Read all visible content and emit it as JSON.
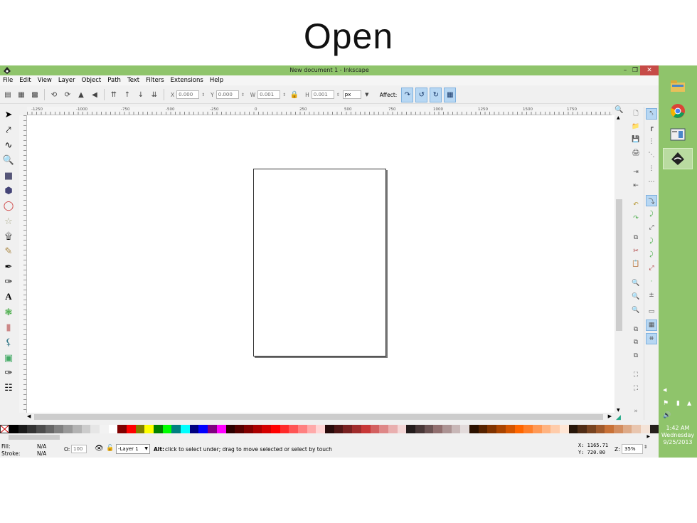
{
  "slide": {
    "title": "Open"
  },
  "window": {
    "title": "New document 1 - Inkscape"
  },
  "menu": [
    "File",
    "Edit",
    "View",
    "Layer",
    "Object",
    "Path",
    "Text",
    "Filters",
    "Extensions",
    "Help"
  ],
  "toolbar": {
    "x_label": "X",
    "x_value": "0.000",
    "y_label": "Y",
    "y_value": "0.000",
    "w_label": "W",
    "w_value": "0.001",
    "h_label": "H",
    "h_value": "0.001",
    "unit": "px",
    "affect_label": "Affect:"
  },
  "ruler": {
    "ticks": [
      "-1250",
      "-1000",
      "-750",
      "-500",
      "-250",
      "0",
      "250",
      "500",
      "750",
      "1000",
      "1250",
      "1500",
      "1750"
    ]
  },
  "palette_colors": [
    "#000000",
    "#1a1a1a",
    "#333333",
    "#4d4d4d",
    "#666666",
    "#808080",
    "#999999",
    "#b3b3b3",
    "#cccccc",
    "#e6e6e6",
    "#f2f2f2",
    "#ffffff",
    "#800000",
    "#ff0000",
    "#808000",
    "#ffff00",
    "#008000",
    "#00ff00",
    "#008080",
    "#00ffff",
    "#000080",
    "#0000ff",
    "#800080",
    "#ff00ff",
    "#2b0000",
    "#550000",
    "#800000",
    "#aa0000",
    "#d40000",
    "#ff0000",
    "#ff2a2a",
    "#ff5555",
    "#ff8080",
    "#ffaaaa",
    "#ffd5d5",
    "#280b0b",
    "#501616",
    "#782121",
    "#a02c2c",
    "#c83737",
    "#d35f5f",
    "#de8787",
    "#e9afaf",
    "#f4d7d7",
    "#241c1c",
    "#483737",
    "#6c5353",
    "#916f6f",
    "#ac9393",
    "#c8b7b7",
    "#e3dbdb",
    "#2b1100",
    "#552200",
    "#803300",
    "#aa4400",
    "#d45500",
    "#ff6600",
    "#ff7f2a",
    "#ff9955",
    "#ffb380",
    "#ffccaa",
    "#ffe6d5",
    "#28170b",
    "#502d16",
    "#784421",
    "#a05a2c",
    "#c87137",
    "#d38d5f",
    "#deaa87",
    "#e9c6af",
    "#f4e3d7",
    "#241f1c"
  ],
  "status": {
    "fill_label": "Fill:",
    "fill_value": "N/A",
    "stroke_label": "Stroke:",
    "stroke_value": "N/A",
    "opacity_label": "O:",
    "opacity_value": "100",
    "layer": "-Layer 1",
    "hint_bold": "Alt:",
    "hint": "click to select under; drag to move selected or select by touch",
    "x_coord": "X: 1165.71",
    "y_coord": "Y:  720.00",
    "zoom_label": "Z:",
    "zoom_value": "35%"
  },
  "taskbar": {
    "time": "1:42 AM",
    "day": "Wednesday",
    "date": "9/25/2013"
  }
}
